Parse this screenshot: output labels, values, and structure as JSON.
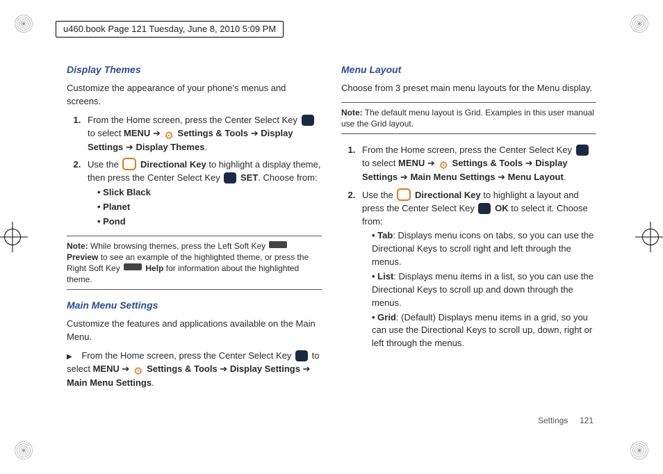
{
  "header_note": "u460.book  Page 121  Tuesday, June 8, 2010  5:09 PM",
  "footer": {
    "section": "Settings",
    "page": "121"
  },
  "left": {
    "sec1": {
      "title": "Display Themes",
      "intro": "Customize the appearance of your phone's menus and screens.",
      "step1_a": "From the Home screen, press the Center Select Key ",
      "step1_b": " to select ",
      "menu": "MENU",
      "nav1_a": "Settings & Tools",
      "nav1_b": "Display Settings",
      "nav1_c": "Display Themes",
      "step2_a": "Use the ",
      "dirkey": "Directional Key",
      "step2_b": " to highlight a display theme, then press the Center Select Key ",
      "set": "SET",
      "step2_tail": ".  Choose from:",
      "opts": [
        "Slick Black",
        "Planet",
        "Pond"
      ],
      "note_lbl": "Note:",
      "note_a": " While browsing themes, press the Left Soft Key ",
      "note_prev": "Preview",
      "note_b": " to see an example of the highlighted theme, or press the Right Soft Key ",
      "note_help": "Help",
      "note_c": " for information about the highlighted theme."
    },
    "sec2": {
      "title": "Main Menu Settings",
      "intro": "Customize the features and applications available on the Main Menu.",
      "step_a": "From the Home screen, press the Center Select Key ",
      "step_b": " to select ",
      "menu": "MENU",
      "nav_a": "Settings & Tools",
      "nav_b": "Display Settings",
      "nav_c": "Main Menu Settings",
      "period": "."
    }
  },
  "right": {
    "sec1": {
      "title": "Menu Layout",
      "intro": "Choose from 3 preset main menu layouts for the Menu display.",
      "note_lbl": "Note:",
      "note_txt": " The default menu layout is Grid. Examples in this user manual use the Grid layout.",
      "step1_a": "From the Home screen, press the Center Select Key ",
      "step1_b": " to select ",
      "menu": "MENU",
      "nav_a": "Settings & Tools",
      "nav_b": "Display Settings",
      "nav_c": "Main Menu Settings",
      "nav_d": "Menu Layout",
      "step2_a": "Use the ",
      "dirkey": "Directional Key",
      "step2_b": " to highlight a layout and press the Center Select Key ",
      "ok": "OK",
      "step2_tail": " to select it. Choose from:",
      "opt1_b": "Tab",
      "opt1_t": ": Displays menu icons on tabs, so you can use the Directional Keys to scroll right and left through the menus.",
      "opt2_b": "List",
      "opt2_t": ": Displays menu items in a list, so you can use the Directional Keys to scroll up and down through the menus.",
      "opt3_b": "Grid",
      "opt3_t": ": (Default) Displays menu items in a grid, so you can use the Directional Keys to scroll up, down, right or left through the menus."
    }
  }
}
